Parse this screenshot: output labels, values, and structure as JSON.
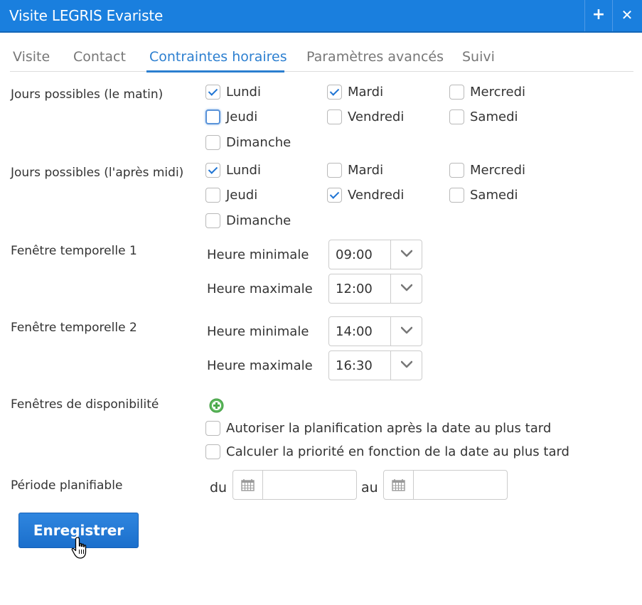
{
  "window": {
    "title": "Visite LEGRIS Evariste",
    "add_icon": "plus-icon",
    "close_icon": "close-icon"
  },
  "tabs": [
    {
      "label": "Visite",
      "active": false
    },
    {
      "label": "Contact",
      "active": false
    },
    {
      "label": "Contraintes horaires",
      "active": true
    },
    {
      "label": "Paramètres avancés",
      "active": false
    },
    {
      "label": "Suivi",
      "active": false
    }
  ],
  "morning": {
    "label": "Jours possibles (le matin)",
    "days": [
      {
        "label": "Lundi",
        "checked": true
      },
      {
        "label": "Mardi",
        "checked": true
      },
      {
        "label": "Mercredi",
        "checked": false
      },
      {
        "label": "Jeudi",
        "checked": false,
        "focused": true
      },
      {
        "label": "Vendredi",
        "checked": false
      },
      {
        "label": "Samedi",
        "checked": false
      },
      {
        "label": "Dimanche",
        "checked": false
      }
    ]
  },
  "afternoon": {
    "label": "Jours possibles (l'après midi)",
    "days": [
      {
        "label": "Lundi",
        "checked": true
      },
      {
        "label": "Mardi",
        "checked": false
      },
      {
        "label": "Mercredi",
        "checked": false
      },
      {
        "label": "Jeudi",
        "checked": false
      },
      {
        "label": "Vendredi",
        "checked": true
      },
      {
        "label": "Samedi",
        "checked": false
      },
      {
        "label": "Dimanche",
        "checked": false
      }
    ]
  },
  "window1": {
    "label": "Fenêtre temporelle 1",
    "min_label": "Heure minimale",
    "min": "09:00",
    "max_label": "Heure maximale",
    "max": "12:00"
  },
  "window2": {
    "label": "Fenêtre temporelle 2",
    "min_label": "Heure minimale",
    "min": "14:00",
    "max_label": "Heure maximale",
    "max": "16:30"
  },
  "availability": {
    "label": "Fenêtres de disponibilité",
    "add_icon": "add-circle-icon",
    "options": [
      {
        "label": "Autoriser la planification après la date au plus tard",
        "checked": false
      },
      {
        "label": "Calculer la priorité en fonction de la date au plus tard",
        "checked": false
      }
    ]
  },
  "period": {
    "label": "Période planifiable",
    "from_label": "du",
    "to_label": "au",
    "from_value": "",
    "to_value": "",
    "calendar_icon": "calendar-icon"
  },
  "colors": {
    "accent": "#1a7fde",
    "tab_active": "#2c7fd0",
    "check": "#1f74d4",
    "add_green": "#5cb85c"
  },
  "save_button": {
    "label": "Enregistrer"
  }
}
